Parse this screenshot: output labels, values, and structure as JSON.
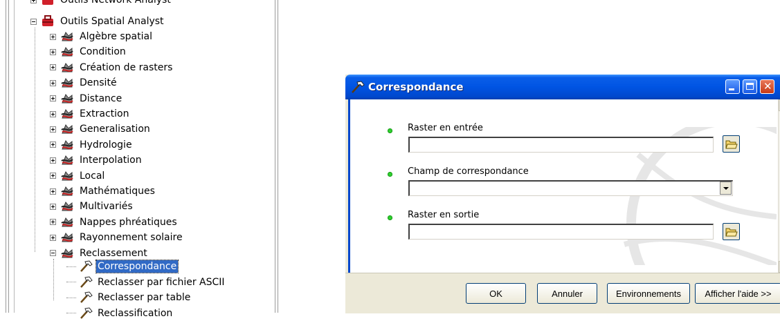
{
  "tree": {
    "partial_top_label": "Outils Network Analyst",
    "parent_label": "Outils Spatial Analyst",
    "categories": [
      "Algèbre spatial",
      "Condition",
      "Création de rasters",
      "Densité",
      "Distance",
      "Extraction",
      "Generalisation",
      "Hydrologie",
      "Interpolation",
      "Local",
      "Mathématiques",
      "Multivariés",
      "Nappes phréatiques",
      "Rayonnement solaire",
      "Reclassement"
    ],
    "tools": [
      "Correspondance",
      "Reclasser par fichier ASCII",
      "Reclasser par table",
      "Reclassification"
    ],
    "selected_tool": "Correspondance"
  },
  "dialog": {
    "title": "Correspondance",
    "fields": [
      {
        "label": "Raster en entrée",
        "value": ""
      },
      {
        "label": "Champ de correspondance",
        "value": ""
      },
      {
        "label": "Raster en sortie",
        "value": ""
      }
    ],
    "buttons": {
      "ok": "OK",
      "cancel": "Annuler",
      "env": "Environnements",
      "help": "Afficher l'aide >>"
    }
  },
  "colors": {
    "title_bar": "#0054e3",
    "selection": "#316ac5",
    "required_bullet": "#2fd12f",
    "dialog_face": "#ece9d8"
  }
}
